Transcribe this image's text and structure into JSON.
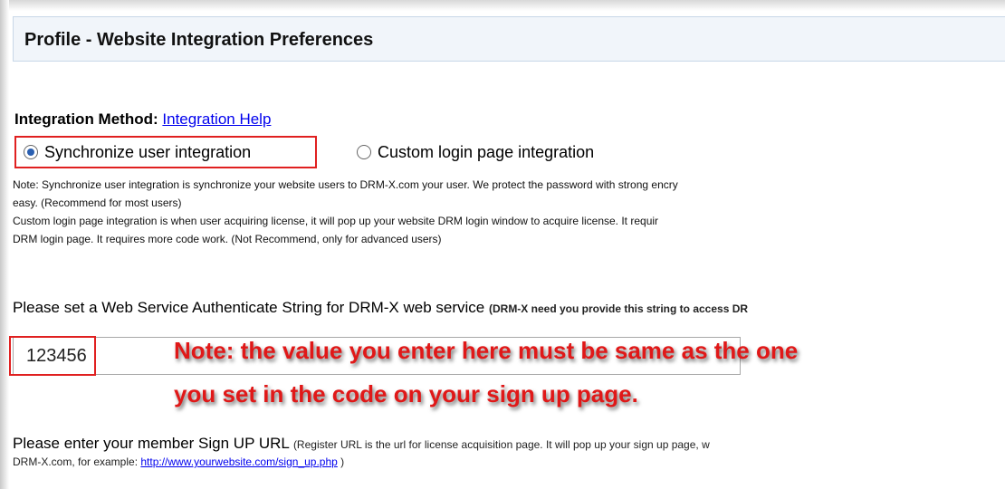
{
  "header": {
    "title": "Profile - Website Integration Preferences"
  },
  "integration": {
    "label": "Integration Method:",
    "help_link": "Integration Help",
    "options": [
      {
        "label": "Synchronize user integration",
        "selected": true
      },
      {
        "label": "Custom login page integration",
        "selected": false
      }
    ],
    "notes": [
      "Note: Synchronize user integration is synchronize your website users to DRM-X.com your user. We protect the password with strong encry",
      "easy. (Recommend for most users)",
      "Custom login page integration is when user acquiring license, it will pop up your website DRM login window to acquire license. It requir",
      "DRM login page. It requires more code work. (Not Recommend, only for advanced users)"
    ]
  },
  "web_service": {
    "label": "Please set a Web Service Authenticate String for DRM-X web service",
    "hint": "(DRM-X need you provide this string to access DR",
    "value": "123456"
  },
  "annotation": {
    "line1": "Note: the value you enter here must be same as the one",
    "line2": "you set in the code on your sign up page."
  },
  "signup": {
    "label": "Please enter your member Sign UP URL",
    "hint": "(Register URL is the url for license acquisition page. It will pop up your sign up page, w",
    "example_prefix": "DRM-X.com, for example: ",
    "example_link": "http://www.yourwebsite.com/sign_up.php",
    "example_suffix": " )"
  },
  "colors": {
    "highlight": "#e02020",
    "annotation": "#e01818",
    "link": "#0000ee",
    "header_bg": "#f1f5fa"
  }
}
